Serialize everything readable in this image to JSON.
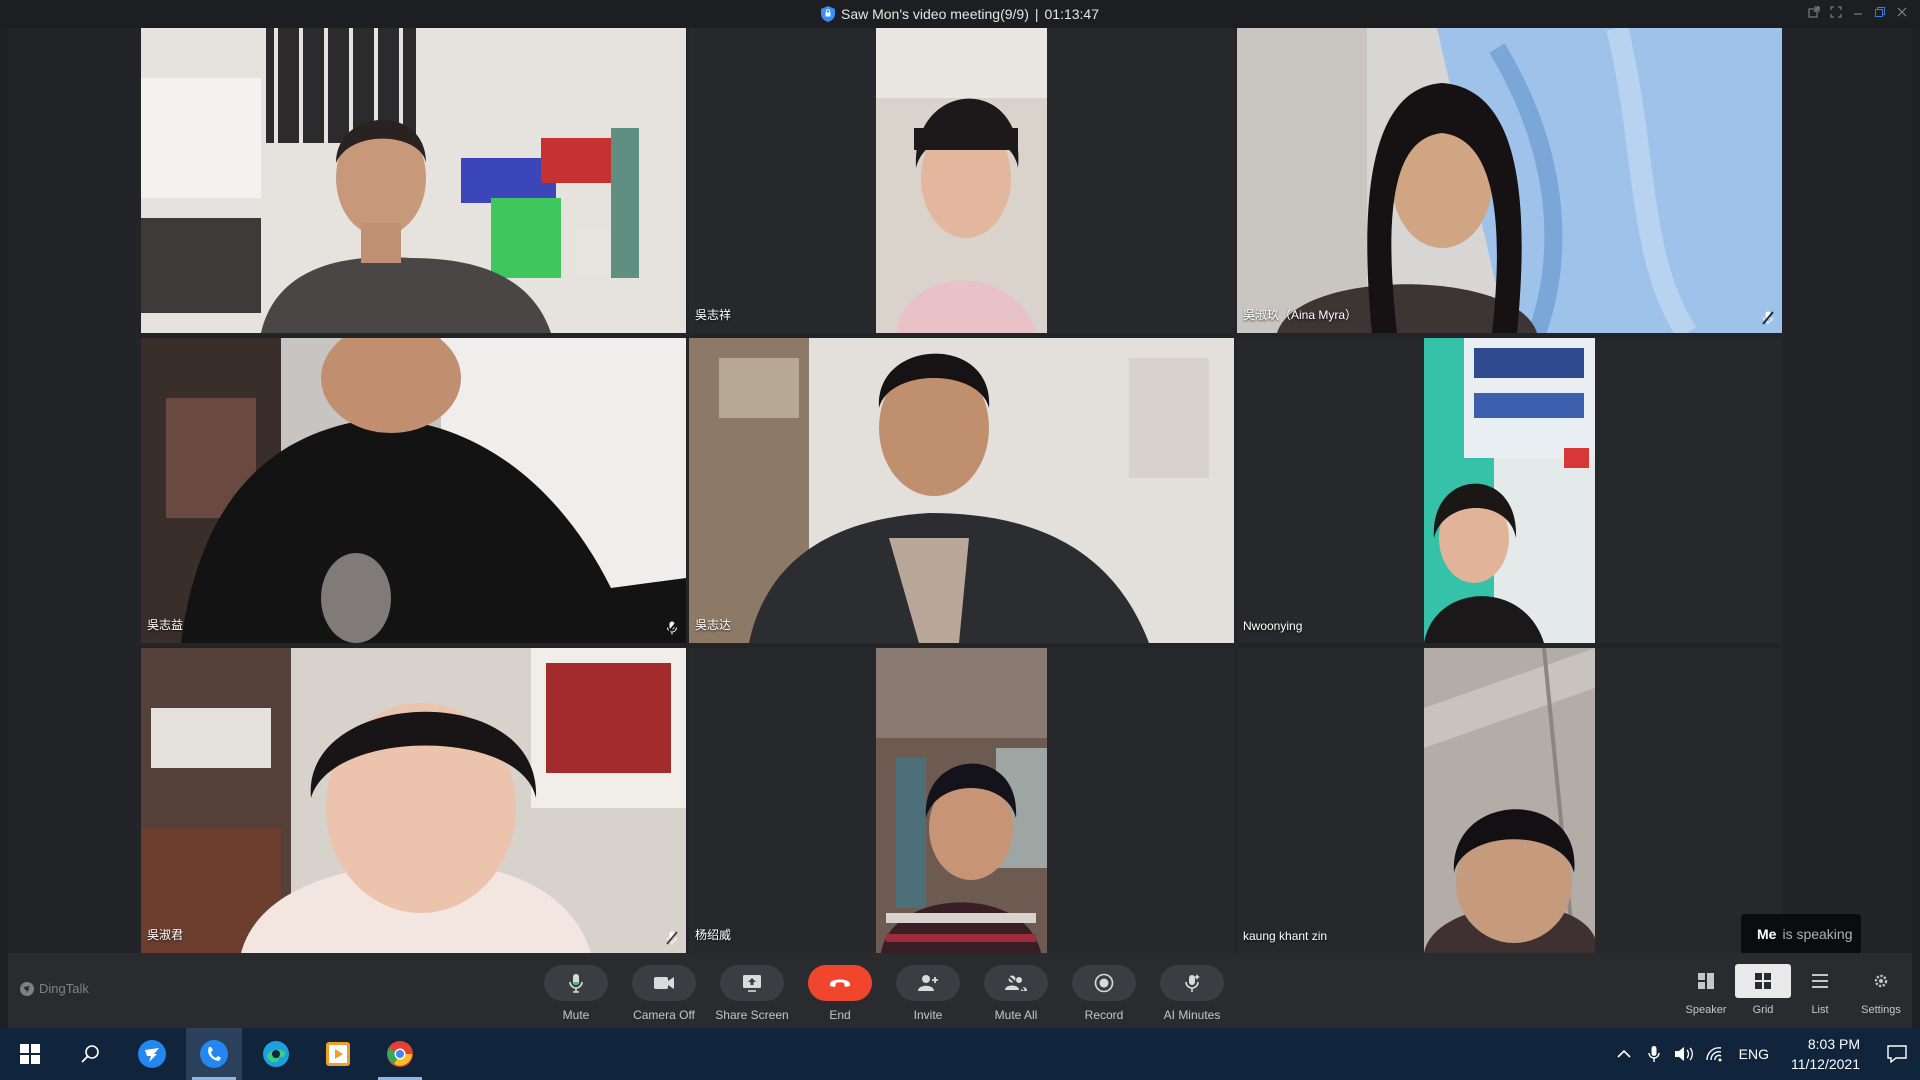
{
  "window": {
    "title": "Saw Mon's video meeting(9/9)",
    "separator": "|",
    "timer": "01:13:47",
    "controls": [
      "popout-icon",
      "fullscreen-icon",
      "minimize-icon",
      "restore-icon",
      "close-icon"
    ]
  },
  "participants": [
    {
      "name": "",
      "active_speaker": true,
      "muted": false
    },
    {
      "name": "吳志祥",
      "active_speaker": false,
      "muted": false
    },
    {
      "name": "吳淑玖（Aina  Myra）",
      "active_speaker": false,
      "muted": true
    },
    {
      "name": "吳志益",
      "active_speaker": false,
      "muted": true
    },
    {
      "name": "吳志达",
      "active_speaker": false,
      "muted": false
    },
    {
      "name": "Nwoonying",
      "active_speaker": false,
      "muted": false
    },
    {
      "name": "吳淑君",
      "active_speaker": false,
      "muted": true
    },
    {
      "name": "杨绍威",
      "active_speaker": false,
      "muted": false
    },
    {
      "name": "kaung khant zin",
      "active_speaker": false,
      "muted": false
    }
  ],
  "speaking": {
    "who": "Me",
    "text": "is speaking"
  },
  "toolbar": {
    "brand": "DingTalk",
    "buttons": [
      {
        "label": "Mute",
        "icon": "microphone-icon"
      },
      {
        "label": "Camera Off",
        "icon": "video-camera-icon"
      },
      {
        "label": "Share Screen",
        "icon": "share-screen-icon"
      },
      {
        "label": "End",
        "icon": "hang-up-icon"
      },
      {
        "label": "Invite",
        "icon": "add-person-icon"
      },
      {
        "label": "Mute All",
        "icon": "mute-all-icon"
      },
      {
        "label": "Record",
        "icon": "record-icon"
      },
      {
        "label": "AI Minutes",
        "icon": "ai-minutes-icon"
      }
    ],
    "layouts": [
      {
        "label": "Speaker",
        "icon": "speaker-layout-icon",
        "selected": false
      },
      {
        "label": "Grid",
        "icon": "grid-layout-icon",
        "selected": true
      },
      {
        "label": "List",
        "icon": "list-layout-icon",
        "selected": false
      }
    ],
    "settings_label": "Settings"
  },
  "taskbar": {
    "apps": [
      "windows-start-icon",
      "search-icon",
      "app-blue-bird-icon",
      "dingtalk-icon",
      "edge-icon",
      "media-player-icon",
      "chrome-icon"
    ],
    "tray": {
      "language": "ENG",
      "time": "8:03 PM",
      "date": "11/12/2021"
    }
  },
  "colors": {
    "accent_green": "#2fb25f",
    "end_red": "#f0462d",
    "taskbar": "#10243c"
  }
}
